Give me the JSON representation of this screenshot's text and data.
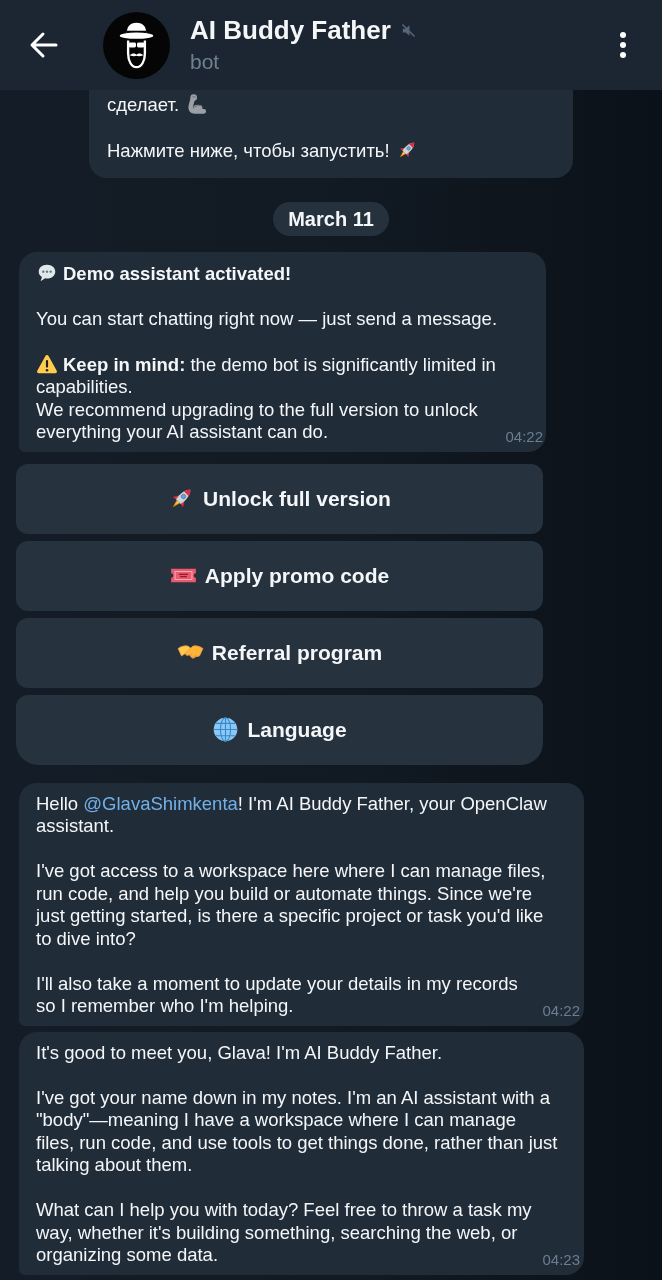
{
  "header": {
    "title": "AI Buddy Father",
    "subtitle": "bot",
    "muted": true
  },
  "chat": [
    {
      "kind": "card",
      "paragraphs": [
        {
          "kind": "text",
          "text": "сделает."
        },
        {
          "kind": "text",
          "text": "Нажмите ниже, чтобы запустить!"
        }
      ]
    },
    {
      "kind": "date",
      "text": "March 11"
    },
    {
      "kind": "message",
      "time": "04:22",
      "paragraphs": [
        {
          "kind": "heading",
          "text": "Demo assistant activated!"
        },
        {
          "kind": "text",
          "text": "You can start chatting right now — just send a message."
        },
        {
          "kind": "text",
          "text": "**Keep in mind:** the demo bot is significantly limited in capabilities.\nWe recommend upgrading to the full version to unlock everything your AI assistant can do."
        }
      ]
    },
    {
      "kind": "keyboard",
      "buttons": [
        "Unlock full version",
        "Apply promo code",
        "Referral program",
        "Language"
      ]
    },
    {
      "kind": "message",
      "time": "04:22",
      "paragraphs": [
        {
          "kind": "mention",
          "before": "Hello ",
          "mention": "@GlavaShimkenta",
          "after": "! I'm AI Buddy Father, your OpenClaw assistant."
        },
        {
          "kind": "text",
          "text": "I've got access to a workspace here where I can manage files, run code, and help you build or automate things. Since we're just getting started, is there a specific project or task you'd like to dive into?"
        },
        {
          "kind": "text",
          "text": "I'll also take a moment to update your details in my records so I remember who I'm helping."
        }
      ]
    },
    {
      "kind": "message",
      "time": "04:23",
      "paragraphs": [
        {
          "kind": "text",
          "text": "It's good to meet you, Glava! I'm AI Buddy Father."
        },
        {
          "kind": "text",
          "text": "I've got your name down in my notes. I'm an AI assistant with a \"body\"—meaning I have a workspace where I can manage files, run code, and use tools to get things done, rather than just talking about them."
        },
        {
          "kind": "text",
          "text": "What can I help you with today? Feel free to throw a task my way, whether it's building something, searching the web, or organizing some data."
        }
      ]
    }
  ]
}
